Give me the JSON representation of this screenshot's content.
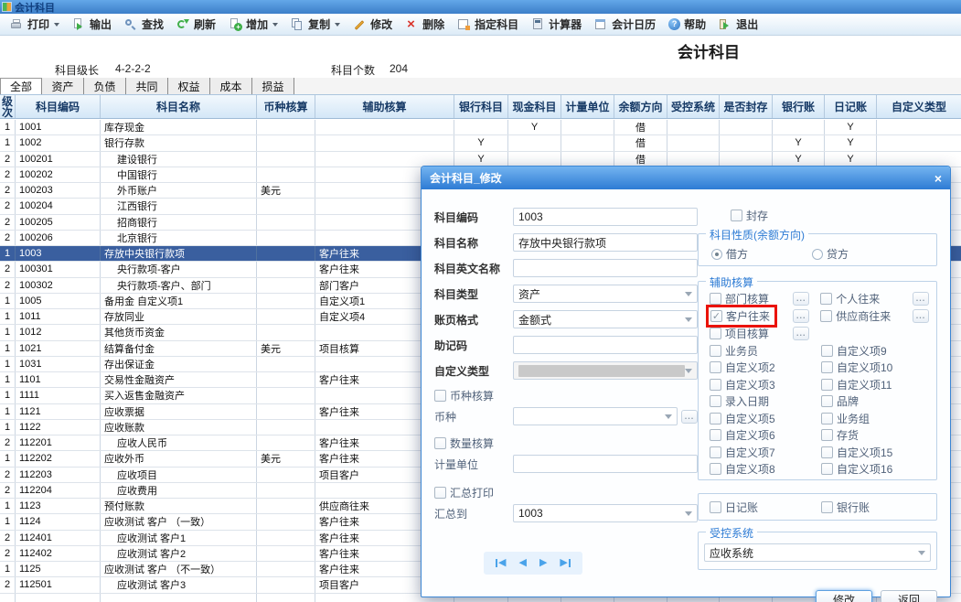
{
  "window": {
    "title": "会计科目"
  },
  "toolbar": {
    "items": [
      {
        "label": "打印",
        "icon": "printer-icon",
        "dropdown": true
      },
      {
        "label": "输出",
        "icon": "export-icon"
      },
      {
        "label": "查找",
        "icon": "search-icon"
      },
      {
        "label": "刷新",
        "icon": "refresh-icon"
      },
      {
        "label": "增加",
        "icon": "add-icon",
        "dropdown": true
      },
      {
        "label": "复制",
        "icon": "copy-icon",
        "dropdown": true
      },
      {
        "label": "修改",
        "icon": "edit-icon"
      },
      {
        "label": "删除",
        "icon": "delete-icon"
      },
      {
        "label": "指定科目",
        "icon": "assign-icon"
      },
      {
        "label": "计算器",
        "icon": "calculator-icon"
      },
      {
        "label": "会计日历",
        "icon": "calendar-icon"
      },
      {
        "label": "帮助",
        "icon": "help-icon"
      },
      {
        "label": "退出",
        "icon": "exit-icon"
      }
    ]
  },
  "info": {
    "level_label": "科目级长",
    "level_value": "4-2-2-2",
    "count_label": "科目个数",
    "count_value": "204",
    "page_title": "会计科目"
  },
  "tabs": [
    "全部",
    "资产",
    "负债",
    "共同",
    "权益",
    "成本",
    "损益"
  ],
  "active_tab": "全部",
  "table": {
    "columns": [
      "级次",
      "科目编码",
      "科目名称",
      "币种核算",
      "辅助核算",
      "银行科目",
      "现金科目",
      "计量单位",
      "余额方向",
      "受控系统",
      "是否封存",
      "银行账",
      "日记账",
      "自定义类型"
    ],
    "rows": [
      {
        "lv": "1",
        "code": "1001",
        "name": "库存现金",
        "cash": "Y",
        "dir": "借",
        "jrn": "Y"
      },
      {
        "lv": "1",
        "code": "1002",
        "name": "银行存款",
        "bank": "Y",
        "dir": "借",
        "bacc": "Y",
        "jrn": "Y"
      },
      {
        "lv": "2",
        "code": "100201",
        "name": "建设银行",
        "bank": "Y",
        "dir": "借",
        "bacc": "Y",
        "jrn": "Y"
      },
      {
        "lv": "2",
        "code": "100202",
        "name": "中国银行"
      },
      {
        "lv": "2",
        "code": "100203",
        "name": "外币账户",
        "cur": "美元"
      },
      {
        "lv": "2",
        "code": "100204",
        "name": "江西银行"
      },
      {
        "lv": "2",
        "code": "100205",
        "name": "招商银行"
      },
      {
        "lv": "2",
        "code": "100206",
        "name": "北京银行"
      },
      {
        "lv": "1",
        "code": "1003",
        "name": "存放中央银行款项",
        "aux": "客户往来",
        "sel": true
      },
      {
        "lv": "2",
        "code": "100301",
        "name": "央行款项-客户",
        "aux": "客户往来"
      },
      {
        "lv": "2",
        "code": "100302",
        "name": "央行款项-客户、部门",
        "aux": "部门客户"
      },
      {
        "lv": "1",
        "code": "1005",
        "name": "备用金 自定义项1",
        "aux": "自定义项1"
      },
      {
        "lv": "1",
        "code": "1011",
        "name": "存放同业",
        "aux": "自定义项4"
      },
      {
        "lv": "1",
        "code": "1012",
        "name": "其他货币资金"
      },
      {
        "lv": "1",
        "code": "1021",
        "name": "结算备付金",
        "cur": "美元",
        "aux": "项目核算"
      },
      {
        "lv": "1",
        "code": "1031",
        "name": "存出保证金"
      },
      {
        "lv": "1",
        "code": "1101",
        "name": "交易性金融资产",
        "aux": "客户往来"
      },
      {
        "lv": "1",
        "code": "1111",
        "name": "买入返售金融资产"
      },
      {
        "lv": "1",
        "code": "1121",
        "name": "应收票据",
        "aux": "客户往来"
      },
      {
        "lv": "1",
        "code": "1122",
        "name": "应收账款"
      },
      {
        "lv": "2",
        "code": "112201",
        "name": "应收人民币",
        "aux": "客户往来"
      },
      {
        "lv": "1",
        "code": "112202",
        "name": "应收外币",
        "cur": "美元",
        "aux": "客户往来"
      },
      {
        "lv": "2",
        "code": "112203",
        "name": "应收项目",
        "aux": "项目客户"
      },
      {
        "lv": "2",
        "code": "112204",
        "name": "应收费用"
      },
      {
        "lv": "1",
        "code": "1123",
        "name": "预付账款",
        "aux": "供应商往来"
      },
      {
        "lv": "1",
        "code": "1124",
        "name": "应收测试 客户 （一致）",
        "aux": "客户往来"
      },
      {
        "lv": "2",
        "code": "112401",
        "name": "应收测试 客户1",
        "aux": "客户往来"
      },
      {
        "lv": "2",
        "code": "112402",
        "name": "应收测试 客户2",
        "aux": "客户往来"
      },
      {
        "lv": "1",
        "code": "1125",
        "name": "应收测试 客户 （不一致）",
        "aux": "客户往来"
      },
      {
        "lv": "2",
        "code": "112501",
        "name": "应收测试 客户3",
        "aux": "项目客户"
      },
      {
        "lv": "",
        "code": "",
        "name": ""
      }
    ]
  },
  "modal": {
    "title": "会计科目_修改",
    "close": "×",
    "more_label": "...",
    "fields": {
      "code": {
        "label": "科目编码",
        "value": "1003"
      },
      "name": {
        "label": "科目名称",
        "value": "存放中央银行款项"
      },
      "en_name": {
        "label": "科目英文名称",
        "value": ""
      },
      "type": {
        "label": "科目类型",
        "value": "资产"
      },
      "page_format": {
        "label": "账页格式",
        "value": "金额式"
      },
      "mnemonic": {
        "label": "助记码",
        "value": ""
      },
      "custom_type": {
        "label": "自定义类型",
        "value": ""
      },
      "currency_check": "币种核算",
      "currency": {
        "label": "币种",
        "value": ""
      },
      "qty_check": "数量核算",
      "unit": {
        "label": "计量单位",
        "value": ""
      },
      "sum_check": "汇总打印",
      "sum_to": {
        "label": "汇总到",
        "value": "1003"
      }
    },
    "seal_label": "封存",
    "nature": {
      "title": "科目性质(余额方向)",
      "debit": "借方",
      "credit": "贷方",
      "selected": "借方"
    },
    "aux": {
      "title": "辅助核算",
      "special": [
        {
          "left": "部门核算",
          "left_checked": false,
          "right": "个人往来"
        },
        {
          "left": "客户往来",
          "left_checked": true,
          "highlight": true,
          "right": "供应商往来"
        },
        {
          "left": "项目核算",
          "left_checked": false,
          "right": null
        }
      ],
      "plain": [
        [
          "业务员",
          "自定义项9"
        ],
        [
          "自定义项2",
          "自定义项10"
        ],
        [
          "自定义项3",
          "自定义项11"
        ],
        [
          "录入日期",
          "品牌"
        ],
        [
          "自定义项5",
          "业务组"
        ],
        [
          "自定义项6",
          "存货"
        ],
        [
          "自定义项7",
          "自定义项15"
        ],
        [
          "自定义项8",
          "自定义项16"
        ]
      ]
    },
    "books": [
      "日记账",
      "银行账"
    ],
    "ctrl": {
      "title": "受控系统",
      "value": "应收系统"
    },
    "buttons": {
      "ok": "修改",
      "back": "返回"
    }
  }
}
